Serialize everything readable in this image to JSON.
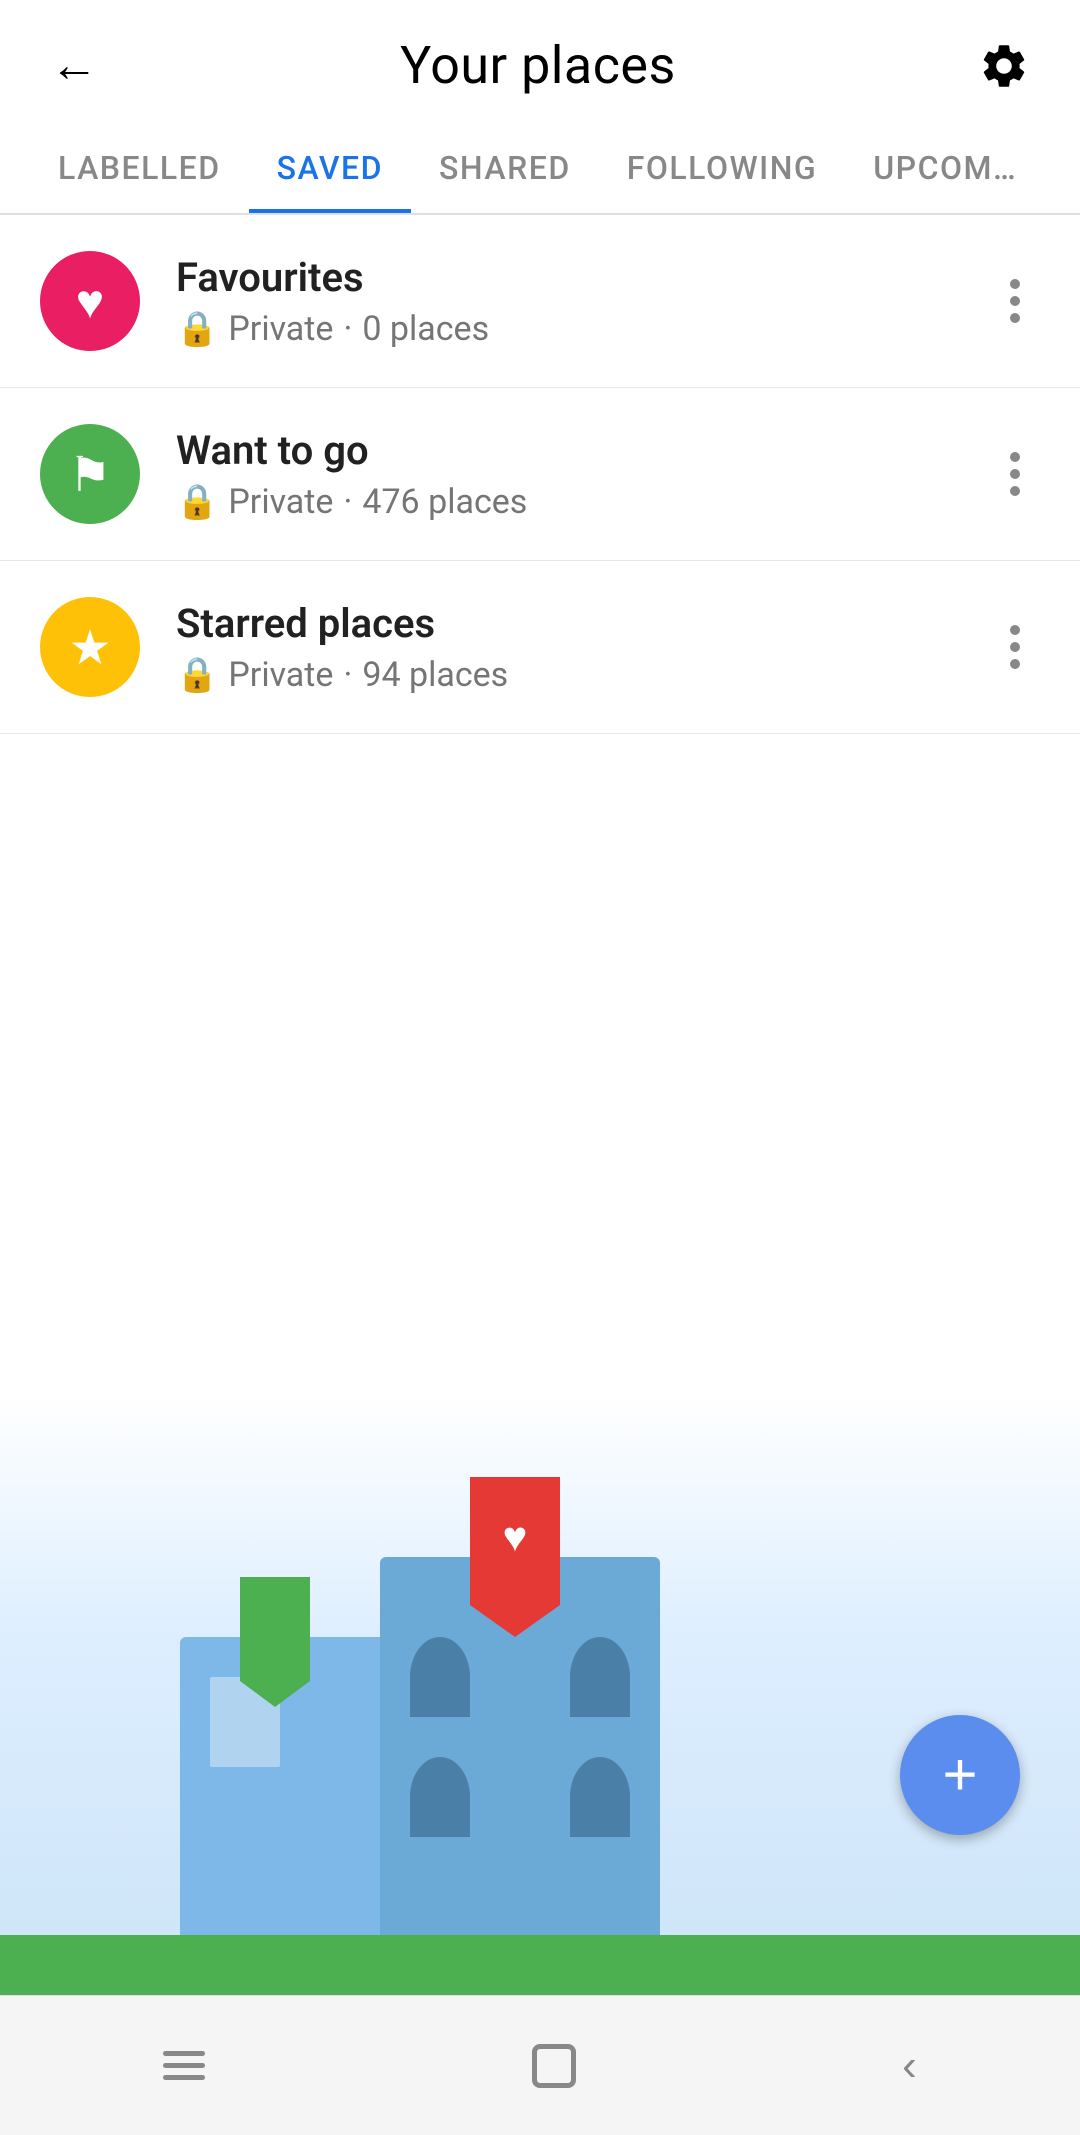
{
  "header": {
    "title": "Your places",
    "back_label": "←",
    "settings_label": "⚙"
  },
  "tabs": {
    "items": [
      {
        "id": "labelled",
        "label": "LABELLED",
        "active": false
      },
      {
        "id": "saved",
        "label": "SAVED",
        "active": true
      },
      {
        "id": "shared",
        "label": "SHARED",
        "active": false
      },
      {
        "id": "following",
        "label": "FOLLOWING",
        "active": false
      },
      {
        "id": "upcoming",
        "label": "UPCOM…",
        "active": false
      }
    ]
  },
  "list": {
    "items": [
      {
        "id": "favourites",
        "icon_color": "pink",
        "icon_type": "heart",
        "title": "Favourites",
        "privacy": "Private",
        "count": "0 places"
      },
      {
        "id": "want-to-go",
        "icon_color": "green",
        "icon_type": "flag",
        "title": "Want to go",
        "privacy": "Private",
        "count": "476 places"
      },
      {
        "id": "starred-places",
        "icon_color": "yellow",
        "icon_type": "star",
        "title": "Starred places",
        "privacy": "Private",
        "count": "94 places"
      }
    ]
  },
  "fab": {
    "label": "+"
  },
  "bottom_nav": {
    "menu_label": "|||",
    "home_label": "○",
    "back_label": "<"
  }
}
